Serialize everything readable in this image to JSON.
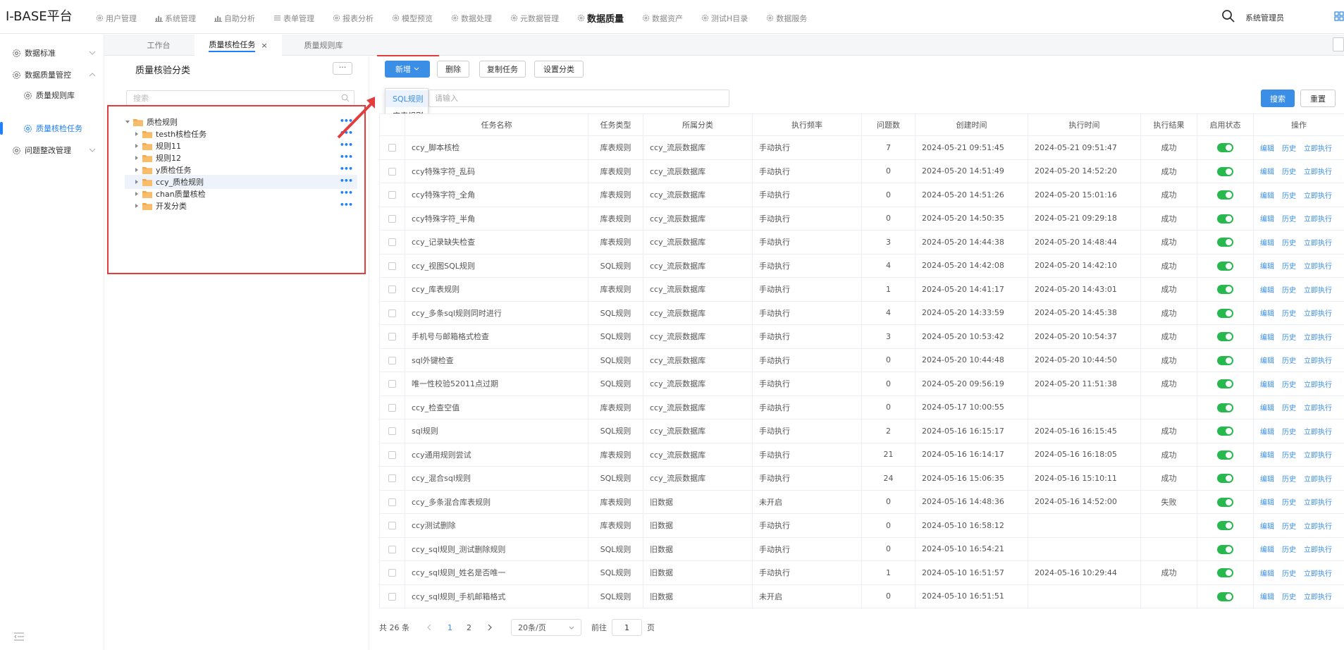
{
  "app": {
    "title": "I-BASE平台"
  },
  "nav": [
    {
      "label": "用户管理",
      "icon": "gear-icon"
    },
    {
      "label": "系统管理",
      "icon": "bar-chart-icon"
    },
    {
      "label": "自助分析",
      "icon": "bar-chart-icon"
    },
    {
      "label": "表单管理",
      "icon": "form-icon"
    },
    {
      "label": "报表分析",
      "icon": "gear-icon"
    },
    {
      "label": "模型预览",
      "icon": "gear-icon"
    },
    {
      "label": "数据处理",
      "icon": "gear-icon"
    },
    {
      "label": "元数据管理",
      "icon": "gear-icon"
    },
    {
      "label": "数据质量",
      "icon": "gear-icon"
    },
    {
      "label": "数据资产",
      "icon": "gear-icon"
    },
    {
      "label": "测试H目录",
      "icon": "gear-icon"
    },
    {
      "label": "数据服务",
      "icon": "gear-icon"
    }
  ],
  "header": {
    "user": "系统管理员"
  },
  "sidebar": {
    "items": [
      {
        "label": "数据标准"
      },
      {
        "label": "数据质量管控"
      },
      {
        "label": "质量规则库"
      },
      {
        "label": "质量核检任务"
      },
      {
        "label": "问题整改管理"
      }
    ]
  },
  "tabs": [
    {
      "label": "工作台"
    },
    {
      "label": "质量核检任务"
    },
    {
      "label": "质量规则库"
    }
  ],
  "category": {
    "title": "质量核验分类",
    "more": "···",
    "search_placeholder": "搜索",
    "tree": [
      {
        "label": "质检规则"
      },
      {
        "label": "testh核检任务"
      },
      {
        "label": "规则11"
      },
      {
        "label": "规则12"
      },
      {
        "label": "y质检任务"
      },
      {
        "label": "ccy_质检规则"
      },
      {
        "label": "chan质量核检"
      },
      {
        "label": "开发分类"
      }
    ]
  },
  "toolbar": {
    "add": "新增",
    "delete": "删除",
    "copy": "复制任务",
    "set_category": "设置分类",
    "dropdown": [
      "SQL规则",
      "库表规则"
    ],
    "search_placeholder": "请输入",
    "search": "搜索",
    "reset": "重置"
  },
  "table": {
    "headers": [
      "任务名称",
      "任务类型",
      "所属分类",
      "执行频率",
      "问题数",
      "创建时间",
      "执行时间",
      "执行结果",
      "启用状态",
      "操作"
    ],
    "ops": [
      "编辑",
      "历史",
      "立即执行"
    ],
    "rows": [
      {
        "name": "ccy_脚本核检",
        "type": "库表规则",
        "cat": "ccy_流辰数据库",
        "freq": "手动执行",
        "issues": "7",
        "created": "2024-05-21 09:51:45",
        "exec": "2024-05-21 09:51:47",
        "result": "成功"
      },
      {
        "name": "ccy特殊字符_乱码",
        "type": "库表规则",
        "cat": "ccy_流辰数据库",
        "freq": "手动执行",
        "issues": "0",
        "created": "2024-05-20 14:51:49",
        "exec": "2024-05-20 14:52:20",
        "result": "成功"
      },
      {
        "name": "ccy特殊字符_全角",
        "type": "库表规则",
        "cat": "ccy_流辰数据库",
        "freq": "手动执行",
        "issues": "0",
        "created": "2024-05-20 14:51:26",
        "exec": "2024-05-20 15:01:16",
        "result": "成功"
      },
      {
        "name": "ccy特殊字符_半角",
        "type": "库表规则",
        "cat": "ccy_流辰数据库",
        "freq": "手动执行",
        "issues": "0",
        "created": "2024-05-20 14:50:35",
        "exec": "2024-05-21 09:29:18",
        "result": "成功"
      },
      {
        "name": "ccy_记录缺失检查",
        "type": "库表规则",
        "cat": "ccy_流辰数据库",
        "freq": "手动执行",
        "issues": "3",
        "created": "2024-05-20 14:44:38",
        "exec": "2024-05-20 14:48:44",
        "result": "成功"
      },
      {
        "name": "ccy_视图SQL规则",
        "type": "SQL规则",
        "cat": "ccy_流辰数据库",
        "freq": "手动执行",
        "issues": "4",
        "created": "2024-05-20 14:42:08",
        "exec": "2024-05-20 14:42:10",
        "result": "成功"
      },
      {
        "name": "ccy_库表规则",
        "type": "库表规则",
        "cat": "ccy_流辰数据库",
        "freq": "手动执行",
        "issues": "1",
        "created": "2024-05-20 14:41:17",
        "exec": "2024-05-20 14:43:01",
        "result": "成功"
      },
      {
        "name": "ccy_多条sql规则同时进行",
        "type": "SQL规则",
        "cat": "ccy_流辰数据库",
        "freq": "手动执行",
        "issues": "4",
        "created": "2024-05-20 14:33:59",
        "exec": "2024-05-20 14:45:38",
        "result": "成功"
      },
      {
        "name": "手机号与邮箱格式检查",
        "type": "SQL规则",
        "cat": "ccy_流辰数据库",
        "freq": "手动执行",
        "issues": "3",
        "created": "2024-05-20 10:53:42",
        "exec": "2024-05-20 10:54:37",
        "result": "成功"
      },
      {
        "name": "sql外键检查",
        "type": "SQL规则",
        "cat": "ccy_流辰数据库",
        "freq": "手动执行",
        "issues": "0",
        "created": "2024-05-20 10:44:48",
        "exec": "2024-05-20 10:44:50",
        "result": "成功"
      },
      {
        "name": "唯一性校验52011点过期",
        "type": "SQL规则",
        "cat": "ccy_流辰数据库",
        "freq": "手动执行",
        "issues": "0",
        "created": "2024-05-20 09:56:19",
        "exec": "2024-05-20 11:51:38",
        "result": "成功"
      },
      {
        "name": "ccy_检查空值",
        "type": "库表规则",
        "cat": "ccy_流辰数据库",
        "freq": "手动执行",
        "issues": "0",
        "created": "2024-05-17 10:00:55",
        "exec": "",
        "result": ""
      },
      {
        "name": "sql规则",
        "type": "SQL规则",
        "cat": "ccy_流辰数据库",
        "freq": "手动执行",
        "issues": "2",
        "created": "2024-05-16 16:15:17",
        "exec": "2024-05-16 16:15:45",
        "result": "成功"
      },
      {
        "name": "ccy通用规则尝试",
        "type": "库表规则",
        "cat": "ccy_流辰数据库",
        "freq": "手动执行",
        "issues": "21",
        "created": "2024-05-16 16:14:17",
        "exec": "2024-05-16 16:18:05",
        "result": "成功"
      },
      {
        "name": "ccy_混合sql规则",
        "type": "SQL规则",
        "cat": "ccy_流辰数据库",
        "freq": "手动执行",
        "issues": "24",
        "created": "2024-05-16 15:06:35",
        "exec": "2024-05-16 15:10:11",
        "result": "成功"
      },
      {
        "name": "ccy_多条混合库表规则",
        "type": "库表规则",
        "cat": "旧数据",
        "freq": "未开启",
        "issues": "0",
        "created": "2024-05-16 14:48:36",
        "exec": "2024-05-16 14:52:00",
        "result": "失败"
      },
      {
        "name": "ccy测试删除",
        "type": "库表规则",
        "cat": "旧数据",
        "freq": "手动执行",
        "issues": "0",
        "created": "2024-05-10 16:58:12",
        "exec": "",
        "result": ""
      },
      {
        "name": "ccy_sql规则_测试删除规则",
        "type": "SQL规则",
        "cat": "旧数据",
        "freq": "手动执行",
        "issues": "0",
        "created": "2024-05-10 16:54:21",
        "exec": "",
        "result": ""
      },
      {
        "name": "ccy_sql规则_姓名是否唯一",
        "type": "SQL规则",
        "cat": "旧数据",
        "freq": "手动执行",
        "issues": "1",
        "created": "2024-05-10 16:51:57",
        "exec": "2024-05-16 10:29:44",
        "result": "成功"
      },
      {
        "name": "ccy_sql规则_手机邮箱格式",
        "type": "SQL规则",
        "cat": "旧数据",
        "freq": "未开启",
        "issues": "0",
        "created": "2024-05-10 16:51:51",
        "exec": "",
        "result": ""
      }
    ]
  },
  "pagination": {
    "total": "共 26 条",
    "pages": [
      "1",
      "2"
    ],
    "page_size": "20条/页",
    "goto_label": "前往",
    "goto_value": "1",
    "page_suffix": "页"
  },
  "colors": {
    "primary": "#3a8ee6",
    "toggle_on": "#27b84e",
    "annotation_red": "#e23c3c"
  }
}
